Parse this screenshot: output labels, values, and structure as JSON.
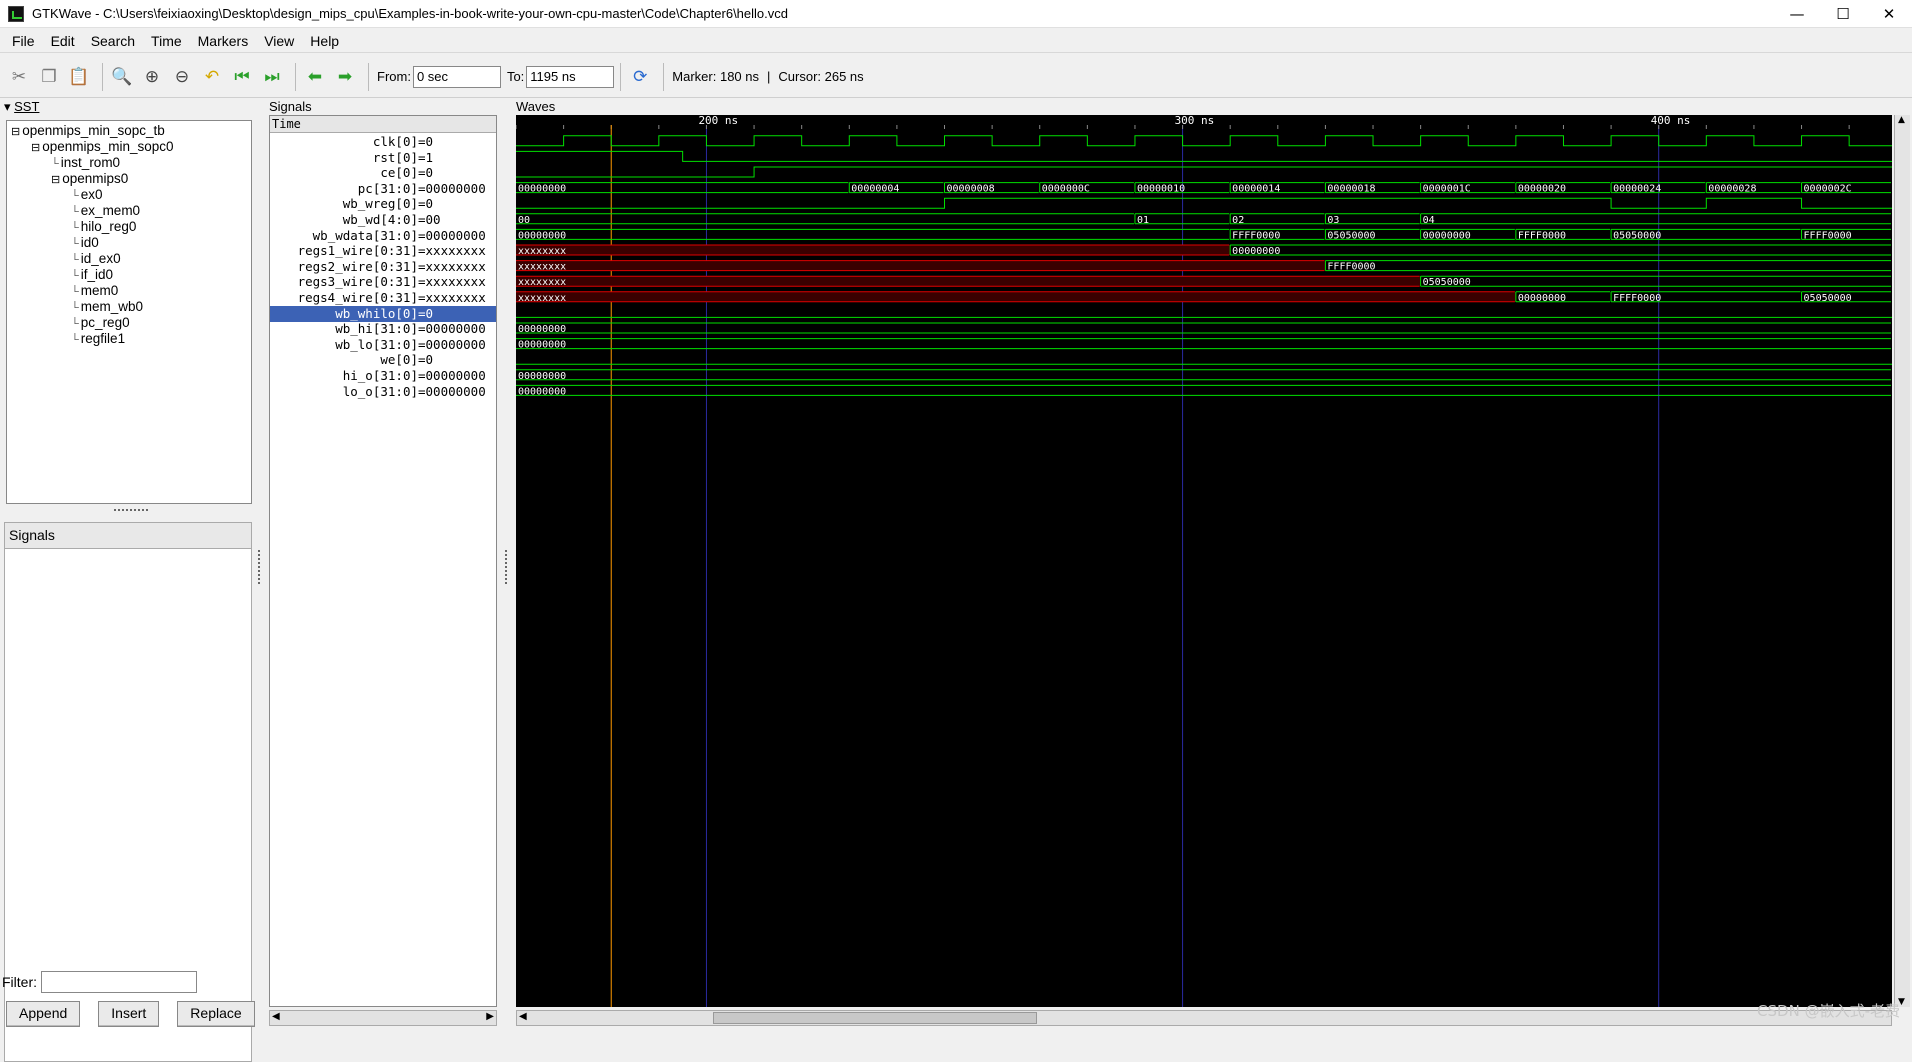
{
  "window": {
    "title": "GTKWave - C:\\Users\\feixiaoxing\\Desktop\\design_mips_cpu\\Examples-in-book-write-your-own-cpu-master\\Code\\Chapter6\\hello.vcd",
    "minimize": "—",
    "maximize": "☐",
    "close": "✕"
  },
  "menu": [
    "File",
    "Edit",
    "Search",
    "Time",
    "Markers",
    "View",
    "Help"
  ],
  "toolbar": {
    "from_label": "From:",
    "from_value": "0 sec",
    "to_label": "To:",
    "to_value": "1195 ns",
    "marker": "Marker: 180 ns",
    "divider": "|",
    "cursor": "Cursor: 265 ns"
  },
  "sst": {
    "header": "SST",
    "tree": [
      {
        "label": "openmips_min_sopc_tb",
        "depth": 0,
        "expander": "⊟"
      },
      {
        "label": "openmips_min_sopc0",
        "depth": 1,
        "expander": "⊟"
      },
      {
        "label": "inst_rom0",
        "depth": 2,
        "expander": ""
      },
      {
        "label": "openmips0",
        "depth": 2,
        "expander": "⊟"
      },
      {
        "label": "ex0",
        "depth": 3,
        "expander": ""
      },
      {
        "label": "ex_mem0",
        "depth": 3,
        "expander": ""
      },
      {
        "label": "hilo_reg0",
        "depth": 3,
        "expander": ""
      },
      {
        "label": "id0",
        "depth": 3,
        "expander": ""
      },
      {
        "label": "id_ex0",
        "depth": 3,
        "expander": ""
      },
      {
        "label": "if_id0",
        "depth": 3,
        "expander": ""
      },
      {
        "label": "mem0",
        "depth": 3,
        "expander": ""
      },
      {
        "label": "mem_wb0",
        "depth": 3,
        "expander": ""
      },
      {
        "label": "pc_reg0",
        "depth": 3,
        "expander": ""
      },
      {
        "label": "regfile1",
        "depth": 3,
        "expander": ""
      }
    ],
    "signals_header": "Signals",
    "filter_label": "Filter:",
    "filter_value": "",
    "buttons": {
      "append": "Append",
      "insert": "Insert",
      "replace": "Replace"
    }
  },
  "signals": {
    "header": "Signals",
    "time_header": "Time",
    "rows": [
      {
        "name": "clk[0]",
        "value": "=0"
      },
      {
        "name": "rst[0]",
        "value": "=1"
      },
      {
        "name": "ce[0]",
        "value": "=0"
      },
      {
        "name": "pc[31:0]",
        "value": "=00000000"
      },
      {
        "name": "wb_wreg[0]",
        "value": "=0"
      },
      {
        "name": "wb_wd[4:0]",
        "value": "=00"
      },
      {
        "name": "wb_wdata[31:0]",
        "value": "=00000000"
      },
      {
        "name": "regs1_wire[0:31]",
        "value": "=xxxxxxxx"
      },
      {
        "name": "regs2_wire[0:31]",
        "value": "=xxxxxxxx"
      },
      {
        "name": "regs3_wire[0:31]",
        "value": "=xxxxxxxx"
      },
      {
        "name": "regs4_wire[0:31]",
        "value": "=xxxxxxxx"
      },
      {
        "name": "wb_whilo[0]",
        "value": "=0",
        "selected": true
      },
      {
        "name": "wb_hi[31:0]",
        "value": "=00000000"
      },
      {
        "name": "wb_lo[31:0]",
        "value": "=00000000"
      },
      {
        "name": "we[0]",
        "value": "=0"
      },
      {
        "name": "hi_o[31:0]",
        "value": "=00000000"
      },
      {
        "name": "lo_o[31:0]",
        "value": "=00000000"
      }
    ]
  },
  "waves": {
    "header": "Waves",
    "time_labels": [
      {
        "t": 200,
        "label": "200 ns"
      },
      {
        "t": 300,
        "label": "300 ns"
      },
      {
        "t": 400,
        "label": "400 ns"
      }
    ],
    "time_start_ns": 160,
    "time_end_ns": 449,
    "marker_ns": 180,
    "cursor_ns": 265,
    "colors": {
      "signal": "#00e000",
      "undefined": "#e00000",
      "text": "#ffffff",
      "marker": "#ff9900",
      "grid": "#2a2aa0"
    },
    "traces": [
      {
        "type": "clock",
        "period": 20,
        "high_start": 170
      },
      {
        "type": "bit",
        "init": 1,
        "edges": [
          [
            195,
            0
          ]
        ]
      },
      {
        "type": "bit",
        "init": 0,
        "edges": [
          [
            210,
            1
          ]
        ]
      },
      {
        "type": "bus",
        "segs": [
          [
            160,
            "00000000"
          ],
          [
            230,
            "00000004"
          ],
          [
            250,
            "00000008"
          ],
          [
            270,
            "0000000C"
          ],
          [
            290,
            "00000010"
          ],
          [
            310,
            "00000014"
          ],
          [
            330,
            "00000018"
          ],
          [
            350,
            "0000001C"
          ],
          [
            370,
            "00000020"
          ],
          [
            390,
            "00000024"
          ],
          [
            410,
            "00000028"
          ],
          [
            430,
            "0000002C"
          ]
        ]
      },
      {
        "type": "bit",
        "init": 0,
        "edges": [
          [
            250,
            1
          ],
          [
            390,
            0
          ],
          [
            410,
            1
          ],
          [
            430,
            0
          ]
        ]
      },
      {
        "type": "bus",
        "segs": [
          [
            160,
            "00"
          ],
          [
            290,
            "01"
          ],
          [
            310,
            "02"
          ],
          [
            330,
            "03"
          ],
          [
            350,
            "04"
          ]
        ]
      },
      {
        "type": "bus",
        "segs": [
          [
            160,
            "00000000"
          ],
          [
            310,
            "FFFF0000"
          ],
          [
            330,
            "05050000"
          ],
          [
            350,
            "00000000"
          ],
          [
            370,
            "FFFF0000"
          ],
          [
            390,
            "05050000"
          ],
          [
            430,
            "FFFF0000"
          ]
        ]
      },
      {
        "type": "bus",
        "segs": [
          [
            160,
            "xxxxxxxx",
            "x"
          ],
          [
            310,
            "00000000"
          ]
        ]
      },
      {
        "type": "bus",
        "segs": [
          [
            160,
            "xxxxxxxx",
            "x"
          ],
          [
            330,
            "FFFF0000"
          ]
        ]
      },
      {
        "type": "bus",
        "segs": [
          [
            160,
            "xxxxxxxx",
            "x"
          ],
          [
            350,
            "05050000"
          ]
        ]
      },
      {
        "type": "bus",
        "segs": [
          [
            160,
            "xxxxxxxx",
            "x"
          ],
          [
            370,
            "00000000"
          ],
          [
            390,
            "FFFF0000"
          ],
          [
            430,
            "05050000"
          ]
        ]
      },
      {
        "type": "bit",
        "init": 0,
        "edges": []
      },
      {
        "type": "bus",
        "segs": [
          [
            160,
            "00000000"
          ]
        ]
      },
      {
        "type": "bus",
        "segs": [
          [
            160,
            "00000000"
          ]
        ]
      },
      {
        "type": "bit",
        "init": 0,
        "edges": []
      },
      {
        "type": "bus",
        "segs": [
          [
            160,
            "00000000"
          ]
        ]
      },
      {
        "type": "bus",
        "segs": [
          [
            160,
            "00000000"
          ]
        ]
      }
    ]
  },
  "watermark": "CSDN @嵌入式-老费"
}
